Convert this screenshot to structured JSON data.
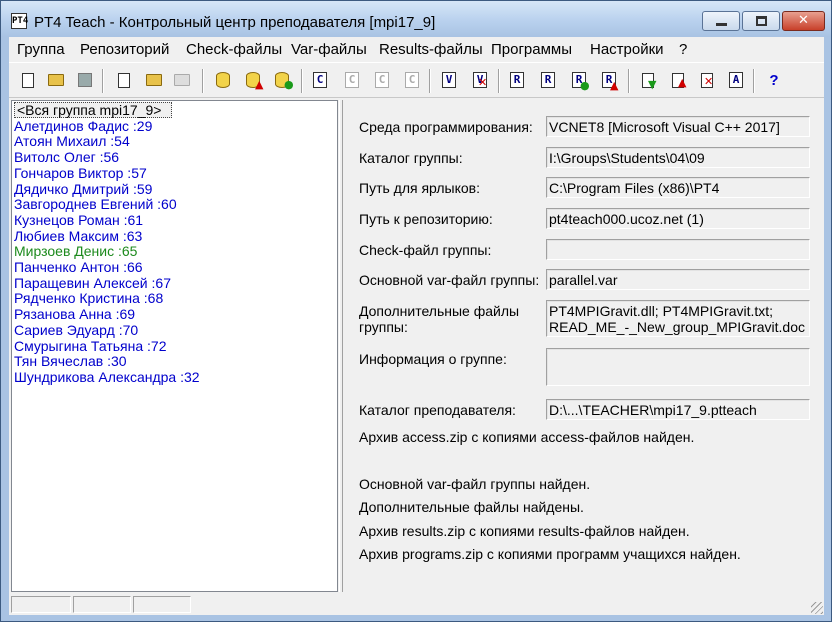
{
  "window": {
    "title": "PT4 Teach - Контрольный центр преподавателя [mpi17_9]",
    "app_icon": "PT4"
  },
  "menu": [
    "Группа",
    "Репозиторий",
    "Check-файлы",
    "Var-файлы",
    "Results-файлы",
    "Программы",
    "Настройки",
    "?"
  ],
  "toolbar": {
    "icons": [
      "new-doc-icon",
      "open-folder-icon",
      "save-icon",
      "search-doc-icon",
      "open-folder-green-icon",
      "folder-disabled-icon",
      "database-icon",
      "database-add-icon",
      "database-edit-icon",
      "check-file-icon",
      "check-file-delete-icon",
      "check-file-edit-icon",
      "check-file-export-icon",
      "var-file-icon",
      "var-file-delete-icon",
      "results-file-icon",
      "results-file-search-icon",
      "results-file-add-icon",
      "results-file-export-icon",
      "program-add-icon",
      "program-upload-icon",
      "program-delete-icon",
      "program-info-icon",
      "help-icon"
    ],
    "letters": {
      "check": "C",
      "var": "V",
      "results": "R",
      "archive": "A",
      "help": "?"
    }
  },
  "students": [
    {
      "name": "<Вся группа mpi17_9>",
      "selected": true,
      "color": "black"
    },
    {
      "name": "Алетдинов Фадис :29",
      "color": "blue"
    },
    {
      "name": "Атоян Михаил :54",
      "color": "blue"
    },
    {
      "name": "Витолс Олег :56",
      "color": "blue"
    },
    {
      "name": "Гончаров Виктор :57",
      "color": "blue"
    },
    {
      "name": "Дядичко Дмитрий :59",
      "color": "blue"
    },
    {
      "name": "Завгороднев Евгений :60",
      "color": "blue"
    },
    {
      "name": "Кузнецов Роман :61",
      "color": "blue"
    },
    {
      "name": "Любиев Максим :63",
      "color": "blue"
    },
    {
      "name": "Мирзоев Денис :65",
      "color": "green"
    },
    {
      "name": "Панченко Антон :66",
      "color": "blue"
    },
    {
      "name": "Паращевин Алексей :67",
      "color": "blue"
    },
    {
      "name": "Рядченко Кристина :68",
      "color": "blue"
    },
    {
      "name": "Рязанова Анна :69",
      "color": "blue"
    },
    {
      "name": "Сариев Эдуард :70",
      "color": "blue"
    },
    {
      "name": "Смурыгина Татьяна :72",
      "color": "blue"
    },
    {
      "name": "Тян Вячеслав :30",
      "color": "blue"
    },
    {
      "name": "Шундрикова Александра :32",
      "color": "blue"
    }
  ],
  "info": {
    "env_label": "Среда программирования:",
    "env_value": "VCNET8 [Microsoft Visual C++ 2017]",
    "group_dir_label": "Каталог группы:",
    "group_dir_value": "I:\\Groups\\Students\\04\\09",
    "shortcut_label": "Путь для ярлыков:",
    "shortcut_value": "C:\\Program Files (x86)\\PT4",
    "repo_label": "Путь к репозиторию:",
    "repo_value": "pt4teach000.ucoz.net (1)",
    "check_label": "Check-файл группы:",
    "check_value": "",
    "var_label": "Основной var-файл группы:",
    "var_value": "parallel.var",
    "extra_label_1": "Дополнительные файлы",
    "extra_label_2": "группы:",
    "extra_value_1": "PT4MPIGravit.dll; PT4MPIGravit.txt;",
    "extra_value_2": "READ_ME_-_New_group_MPIGravit.doc",
    "group_info_label": "Информация о группе:",
    "group_info_value": "",
    "teacher_dir_label": "Каталог преподавателя:",
    "teacher_dir_value": "D:\\...\\TEACHER\\mpi17_9.ptteach"
  },
  "status_messages": [
    "Архив access.zip с копиями access-файлов найден.",
    "Основной var-файл группы найден.",
    "Дополнительные файлы найдены.",
    "Архив results.zip с копиями results-файлов найден.",
    "Архив programs.zip с копиями программ учащихся найден."
  ],
  "statusbar": [
    "",
    "",
    ""
  ],
  "colors": {
    "titlebar": "#b9d1ee",
    "student_default": "#0000cc",
    "student_highlight": "#1d8a1d",
    "chrome": "#f0f0f0"
  }
}
